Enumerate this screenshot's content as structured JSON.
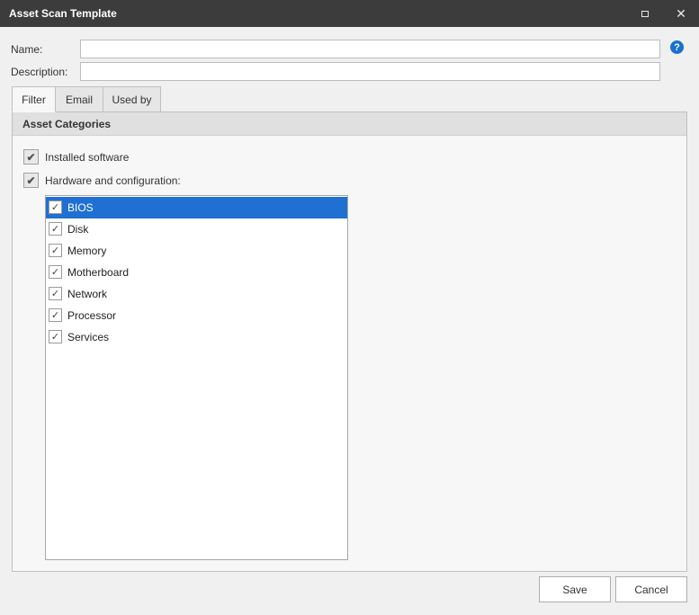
{
  "window": {
    "title": "Asset Scan Template",
    "close_glyph": "✕"
  },
  "form": {
    "name_label": "Name:",
    "name_value": "",
    "description_label": "Description:",
    "description_value": "",
    "help_glyph": "?"
  },
  "tabs": [
    {
      "label": "Filter",
      "active": true
    },
    {
      "label": "Email",
      "active": false
    },
    {
      "label": "Used by",
      "active": false
    }
  ],
  "filter": {
    "section_title": "Asset Categories",
    "installed_software": {
      "label": "Installed software",
      "checked": true
    },
    "hardware": {
      "label": "Hardware and configuration:",
      "checked": true
    },
    "check_glyph": "✔",
    "items": [
      {
        "label": "BIOS",
        "checked": true,
        "selected": true
      },
      {
        "label": "Disk",
        "checked": true,
        "selected": false
      },
      {
        "label": "Memory",
        "checked": true,
        "selected": false
      },
      {
        "label": "Motherboard",
        "checked": true,
        "selected": false
      },
      {
        "label": "Network",
        "checked": true,
        "selected": false
      },
      {
        "label": "Processor",
        "checked": true,
        "selected": false
      },
      {
        "label": "Services",
        "checked": true,
        "selected": false
      }
    ],
    "item_check_glyph": "✓"
  },
  "buttons": {
    "save": "Save",
    "cancel": "Cancel"
  },
  "colors": {
    "titlebar": "#3c3c3c",
    "selection": "#1f70d2",
    "help": "#1a6fd1"
  }
}
